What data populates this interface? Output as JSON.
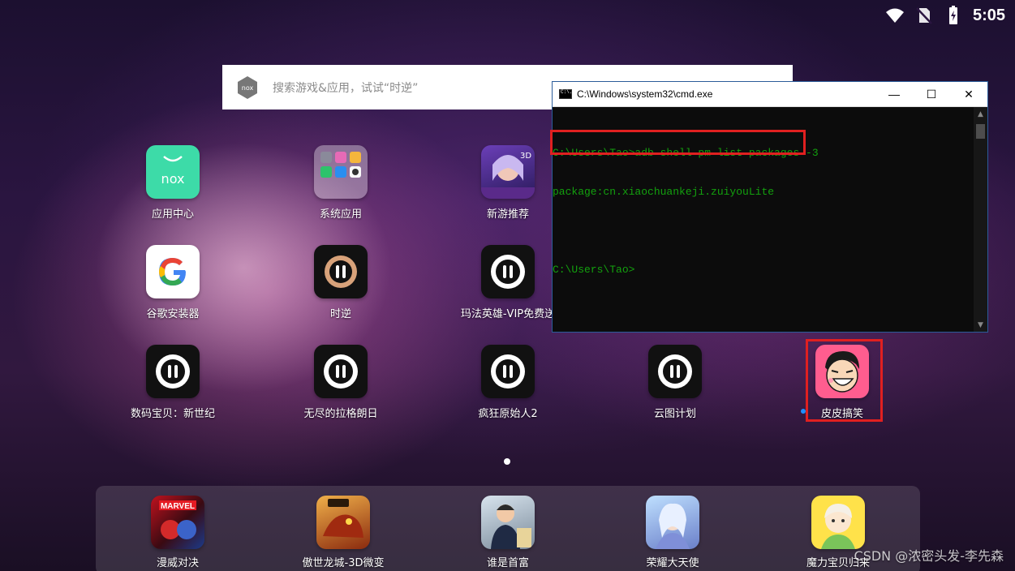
{
  "status_bar": {
    "time": "5:05",
    "icons": [
      "wifi-icon",
      "no-sim-icon",
      "battery-charging-icon"
    ]
  },
  "search": {
    "placeholder": "搜索游戏&应用，试试“时逆”",
    "logo_text": "nox"
  },
  "home_apps": [
    {
      "label": "应用中心",
      "icon": "nox-app-center-icon"
    },
    {
      "label": "系统应用",
      "icon": "system-apps-folder-icon"
    },
    {
      "label": "新游推荐",
      "icon": "new-games-icon"
    },
    {
      "label": "谷歌安装器",
      "icon": "google-icon"
    },
    {
      "label": "时逆",
      "icon": "game-icon"
    },
    {
      "label": "玛法英雄-VIP免费送",
      "icon": "game-icon"
    },
    {
      "label": "数码宝贝：新世纪",
      "icon": "game-icon"
    },
    {
      "label": "无尽的拉格朗日",
      "icon": "game-icon"
    },
    {
      "label": "疯狂原始人2",
      "icon": "game-icon"
    },
    {
      "label": "云图计划",
      "icon": "game-icon"
    },
    {
      "label": "皮皮搞笑",
      "icon": "pipi-funny-icon"
    }
  ],
  "dock_apps": [
    {
      "label": "漫威对决",
      "icon": "marvel-icon"
    },
    {
      "label": "傲世龙城-3D微变",
      "icon": "dragon-icon"
    },
    {
      "label": "谁是首富",
      "icon": "rich-man-icon"
    },
    {
      "label": "荣耀大天使",
      "icon": "archangel-icon"
    },
    {
      "label": "魔力宝贝归来",
      "icon": "crossgate-icon"
    }
  ],
  "cmd": {
    "title": "C:\\Windows\\system32\\cmd.exe",
    "lines": [
      "C:\\Users\\Tao>adb shell pm list packages -3",
      "package:cn.xiaochuankeji.zuiyouLite",
      "",
      "C:\\Users\\Tao>"
    ],
    "minimize": "—",
    "maximize": "☐",
    "close": "✕",
    "icon_text": "C:\\."
  },
  "watermark": "CSDN @浓密头发-李先森",
  "colors": {
    "highlight": "#e02020",
    "console_text": "#13a10e",
    "nox_green": "#3ddba8"
  }
}
